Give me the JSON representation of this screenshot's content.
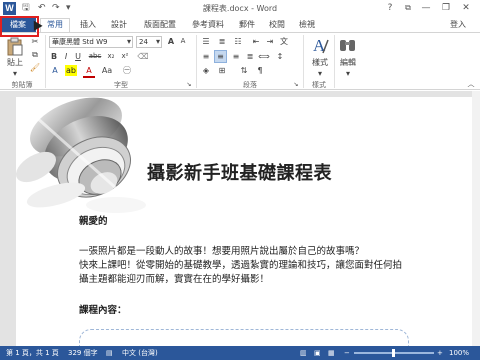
{
  "titlebar": {
    "app_icon": "W",
    "title": "課程表.docx - Word",
    "help": "?",
    "minimize": "—",
    "restore": "❐",
    "close": "✕"
  },
  "qat": {
    "save": "🖫",
    "undo": "↶",
    "redo": "↷",
    "customize": "▾"
  },
  "tabs": {
    "file": "檔案",
    "items": [
      "常用",
      "插入",
      "設計",
      "版面配置",
      "參考資料",
      "郵件",
      "校閱",
      "檢視"
    ],
    "active": "常用",
    "login": "登入"
  },
  "ribbon": {
    "clipboard": {
      "paste": "貼上",
      "label": "剪貼簿"
    },
    "font": {
      "name": "華康黑體 Std W9",
      "size": "24",
      "label": "字型",
      "buttons": [
        "B",
        "I",
        "U",
        "abc",
        "x₂",
        "x²",
        "A",
        "A"
      ]
    },
    "paragraph": {
      "label": "段落"
    },
    "styles": {
      "button": "樣式",
      "label": "樣式"
    },
    "editing": {
      "button": "編輯"
    }
  },
  "document": {
    "heading": "攝影新手班基礎課程表",
    "greeting": "親愛的",
    "body_line1": "一張照片都是一段動人的故事！想要用照片說出屬於自己的故事嗎？",
    "body_line2": "快來上課吧！從零開始的基礎教學，透過紮實的理論和技巧，讓您面對任何拍",
    "body_line3": "攝主題都能迎刃而解，實實在在的學好攝影！",
    "section": "課程內容："
  },
  "statusbar": {
    "page": "第 1 頁，共 1 頁",
    "words": "329 個字",
    "language": "中文 (台灣)",
    "zoom": "100%"
  }
}
